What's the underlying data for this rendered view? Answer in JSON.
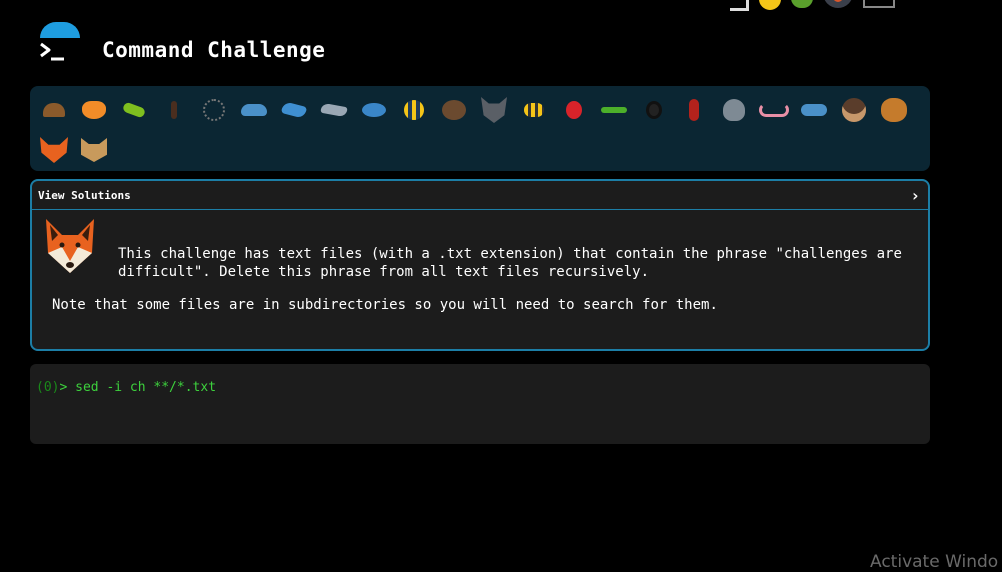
{
  "header": {
    "title": "Command Challenge",
    "logo_icon": "terminal-prompt-icon",
    "accent_color": "#1e9de0"
  },
  "icon_bar": {
    "background_color": "#0b2633",
    "icons": [
      "snail-icon",
      "butterfly-icon",
      "caterpillar-icon",
      "ant-icon",
      "spiderweb-icon",
      "whale-icon",
      "dolphin-icon",
      "dolphin-icon",
      "fish-icon",
      "tropical-fish-icon",
      "beaver-icon",
      "wolf-icon",
      "bee-icon",
      "ladybug-icon",
      "worm-icon",
      "spider-icon",
      "scorpion-icon",
      "fly-icon",
      "worm-icon",
      "microbe-icon",
      "monkey-icon",
      "dog-icon",
      "fox-icon",
      "cat-icon"
    ]
  },
  "solutions": {
    "label": "View Solutions",
    "border_color": "#1c7ea6"
  },
  "challenge": {
    "avatar_icon": "fox-icon",
    "text": "This challenge has text files (with a .txt extension) that contain the phrase \"challenges are difficult\". Delete this phrase from all text files recursively.",
    "note": "Note that some files are in subdirectories so you will need to search for them."
  },
  "terminal": {
    "exit_code": "(0)",
    "prompt_symbol": ">",
    "input": "sed -i ch **/*.txt",
    "text_color": "#3dd13d"
  },
  "watermark": {
    "text": "Activate Windo"
  }
}
